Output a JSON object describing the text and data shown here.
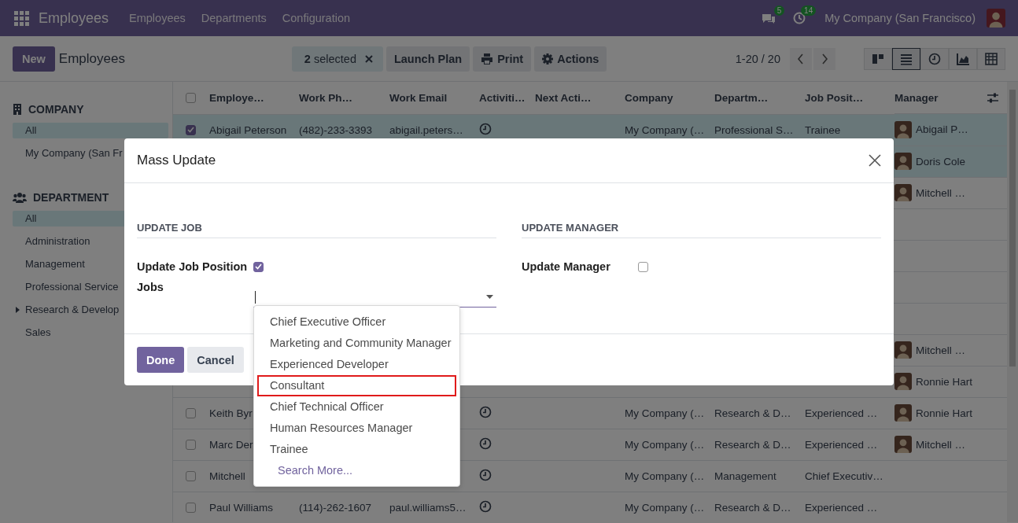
{
  "navbar": {
    "app": "Employees",
    "menus": [
      "Employees",
      "Departments",
      "Configuration"
    ],
    "messages_badge": "5",
    "activities_badge": "14",
    "company": "My Company (San Francisco)"
  },
  "control_panel": {
    "new_button": "New",
    "breadcrumb": "Employees",
    "selection": "**2** selected",
    "actions": [
      {
        "label": "Launch Plan",
        "kind": "plain"
      },
      {
        "label": "Print",
        "kind": "print"
      },
      {
        "label": "Actions",
        "kind": "gear"
      }
    ],
    "pager": "1-20 / 20",
    "views": [
      {
        "kind": "kanban",
        "selected": false
      },
      {
        "kind": "list",
        "selected": true
      },
      {
        "kind": "activity",
        "selected": false
      },
      {
        "kind": "graph",
        "selected": false
      },
      {
        "kind": "pivot",
        "selected": false
      }
    ]
  },
  "sidebar": {
    "sections": [
      {
        "kind": "company",
        "title": "COMPANY",
        "items": [
          {
            "label": "All",
            "selected": true,
            "collapsible": false
          },
          {
            "label": "My Company (San Fr",
            "selected": false,
            "collapsible": false
          }
        ]
      },
      {
        "kind": "department",
        "title": "DEPARTMENT",
        "items": [
          {
            "label": "All",
            "selected": true,
            "collapsible": false
          },
          {
            "label": "Administration",
            "selected": false,
            "collapsible": false
          },
          {
            "label": "Management",
            "selected": false,
            "collapsible": false
          },
          {
            "label": "Professional Service",
            "selected": false,
            "collapsible": false
          },
          {
            "label": "Research & Develop",
            "selected": false,
            "collapsible": true
          },
          {
            "label": "Sales",
            "selected": false,
            "collapsible": false
          }
        ]
      }
    ]
  },
  "table": {
    "all_selected": false,
    "columns": [
      "Employe…",
      "Work Ph…",
      "Work Email",
      "Activiti…",
      "Next Acti…",
      "Company",
      "Departm…",
      "Job Posit…",
      "Manager"
    ],
    "rows": [
      {
        "selected": true,
        "name": "Abigail Peterson",
        "phone": "(482)-233-3393",
        "email": "abigail.peters…",
        "activity": true,
        "company": "My Company (…",
        "department": "Professional S…",
        "job": "Trainee",
        "manager": "Abigail P…"
      },
      {
        "selected": true,
        "manager": "Doris Cole"
      },
      {
        "selected": false,
        "manager": "Mitchell …"
      },
      {
        "selected": false
      },
      {
        "selected": false
      },
      {
        "selected": false
      },
      {
        "selected": false
      },
      {
        "selected": false,
        "manager": "Mitchell …"
      },
      {
        "selected": false,
        "manager": "Ronnie Hart"
      },
      {
        "selected": false,
        "name": "Keith Byr",
        "activity": true,
        "company": "My Company (…",
        "department": "Research & D…",
        "job": "Experienced …",
        "manager": "Ronnie Hart"
      },
      {
        "selected": false,
        "name": "Marc Der",
        "activity": true,
        "company": "My Company (…",
        "department": "Research & D…",
        "job": "Experienced …",
        "manager": "Mitchell …"
      },
      {
        "selected": false,
        "name": "Mitchell",
        "activity": true,
        "company": "My Company (…",
        "department": "Management",
        "job": "Chief Executiv…"
      },
      {
        "selected": false,
        "name": "Paul Williams",
        "phone": "(114)-262-1607",
        "email": "paul.williams5…",
        "activity": true,
        "company": "My Company (…",
        "department": "Research & D…",
        "job": "Experienced …"
      }
    ]
  },
  "dialog": {
    "title": "Mass Update",
    "sections": [
      {
        "title": "UPDATE JOB",
        "fields": [
          {
            "kind": "checkbox",
            "label": "Update Job Position",
            "checked": true
          },
          {
            "kind": "select",
            "label": "Jobs"
          }
        ]
      },
      {
        "title": "UPDATE MANAGER",
        "fields": [
          {
            "kind": "checkbox",
            "label": "Update Manager",
            "checked": false
          }
        ]
      }
    ],
    "buttons": [
      {
        "label": "Done",
        "kind": "primary"
      },
      {
        "label": "Cancel",
        "kind": "secondary"
      }
    ],
    "dropdown": {
      "options": [
        {
          "label": "Chief Executive Officer",
          "highlighted": false
        },
        {
          "label": "Marketing and Community Manager",
          "highlighted": false
        },
        {
          "label": "Experienced Developer",
          "highlighted": false
        },
        {
          "label": "Consultant",
          "highlighted": true
        },
        {
          "label": "Chief Technical Officer",
          "highlighted": false
        },
        {
          "label": "Human Resources Manager",
          "highlighted": false
        },
        {
          "label": "Trainee",
          "highlighted": false
        }
      ],
      "search_more": "Search More..."
    }
  }
}
